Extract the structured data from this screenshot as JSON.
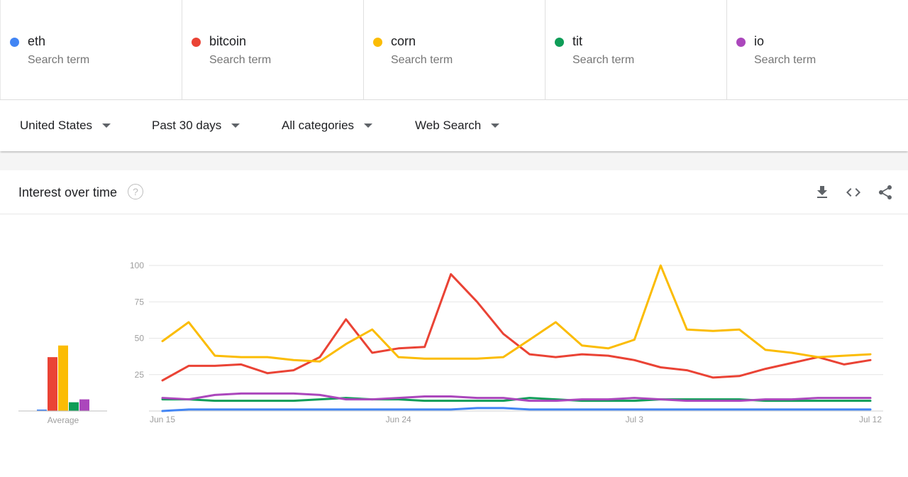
{
  "terms": [
    {
      "name": "eth",
      "sub": "Search term",
      "color": "#4285f4"
    },
    {
      "name": "bitcoin",
      "sub": "Search term",
      "color": "#ea4335"
    },
    {
      "name": "corn",
      "sub": "Search term",
      "color": "#fbbc04"
    },
    {
      "name": "tit",
      "sub": "Search term",
      "color": "#0f9d58"
    },
    {
      "name": "io",
      "sub": "Search term",
      "color": "#ab47bc"
    }
  ],
  "filters": {
    "region": "United States",
    "time": "Past 30 days",
    "category": "All categories",
    "search_type": "Web Search"
  },
  "card": {
    "title": "Interest over time",
    "help": "?",
    "icons": [
      "download-icon",
      "embed-code-icon",
      "share-icon"
    ]
  },
  "chart_data": {
    "type": "line",
    "title": "",
    "ylim": [
      0,
      100
    ],
    "yticks": [
      25,
      50,
      75,
      100
    ],
    "x_tick_labels": [
      "Jun 15",
      "Jun 24",
      "Jul 3",
      "Jul 12"
    ],
    "x": [
      "Jun 15",
      "Jun 16",
      "Jun 17",
      "Jun 18",
      "Jun 19",
      "Jun 20",
      "Jun 21",
      "Jun 22",
      "Jun 23",
      "Jun 24",
      "Jun 25",
      "Jun 26",
      "Jun 27",
      "Jun 28",
      "Jun 29",
      "Jun 30",
      "Jul 1",
      "Jul 2",
      "Jul 3",
      "Jul 4",
      "Jul 5",
      "Jul 6",
      "Jul 7",
      "Jul 8",
      "Jul 9",
      "Jul 10",
      "Jul 11",
      "Jul 12"
    ],
    "series": [
      {
        "name": "eth",
        "color": "#4285f4",
        "values": [
          0,
          1,
          1,
          1,
          1,
          1,
          1,
          1,
          1,
          1,
          1,
          1,
          2,
          2,
          1,
          1,
          1,
          1,
          1,
          1,
          1,
          1,
          1,
          1,
          1,
          1,
          1,
          1
        ]
      },
      {
        "name": "bitcoin",
        "color": "#ea4335",
        "values": [
          21,
          31,
          31,
          32,
          26,
          28,
          37,
          63,
          40,
          43,
          44,
          94,
          75,
          53,
          39,
          37,
          39,
          38,
          35,
          30,
          28,
          23,
          24,
          29,
          33,
          37,
          32,
          35
        ]
      },
      {
        "name": "corn",
        "color": "#fbbc04",
        "values": [
          48,
          61,
          38,
          37,
          37,
          35,
          34,
          46,
          56,
          37,
          36,
          36,
          36,
          37,
          49,
          61,
          45,
          43,
          49,
          100,
          56,
          55,
          56,
          42,
          40,
          37,
          38,
          39
        ]
      },
      {
        "name": "tit",
        "color": "#0f9d58",
        "values": [
          8,
          8,
          7,
          7,
          7,
          7,
          8,
          9,
          8,
          8,
          7,
          7,
          7,
          7,
          9,
          8,
          7,
          7,
          7,
          8,
          8,
          8,
          8,
          7,
          7,
          7,
          7,
          7
        ]
      },
      {
        "name": "io",
        "color": "#ab47bc",
        "values": [
          9,
          8,
          11,
          12,
          12,
          12,
          11,
          8,
          8,
          9,
          10,
          10,
          9,
          9,
          7,
          7,
          8,
          8,
          9,
          8,
          7,
          7,
          7,
          8,
          8,
          9,
          9,
          9
        ]
      }
    ],
    "averages": {
      "label": "Average",
      "values": [
        1,
        37,
        45,
        6,
        8
      ]
    }
  }
}
